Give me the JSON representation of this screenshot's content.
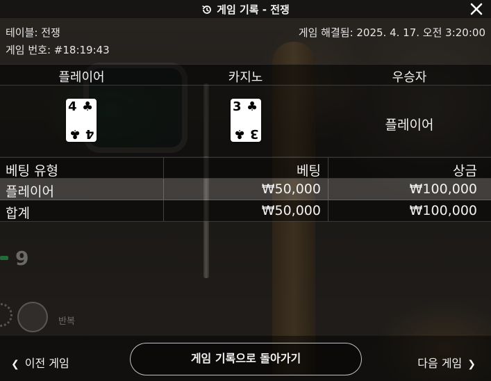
{
  "header": {
    "title": "게임 기록 - 전쟁",
    "icon": "history-icon",
    "close_icon": "close-icon"
  },
  "info": {
    "table": "테이블: 전쟁",
    "game_number": "게임 번호: #18:19:43",
    "resolved_at": "게임 해결됨: 2025. 4. 17. 오전 3:20:00"
  },
  "result": {
    "headers": [
      "플레이어",
      "카지노",
      "우승자"
    ],
    "player_card": {
      "rank": "4",
      "suit": "♣",
      "suit_name": "club-icon"
    },
    "casino_card": {
      "rank": "3",
      "suit": "♣",
      "suit_name": "club-icon"
    },
    "winner": "플레이어"
  },
  "bets": {
    "headers": [
      "베팅 유형",
      "베팅",
      "상금"
    ],
    "rows": [
      {
        "type": "플레이어",
        "bet": "₩50,000",
        "payout": "₩100,000"
      },
      {
        "type": "합계",
        "bet": "₩50,000",
        "payout": "₩100,000"
      }
    ]
  },
  "background_ui": {
    "number": "9",
    "repeat_label": "반복"
  },
  "footer": {
    "prev_label": "이전 게임",
    "back_label": "게임 기록으로 돌아가기",
    "next_label": "다음 게임"
  }
}
